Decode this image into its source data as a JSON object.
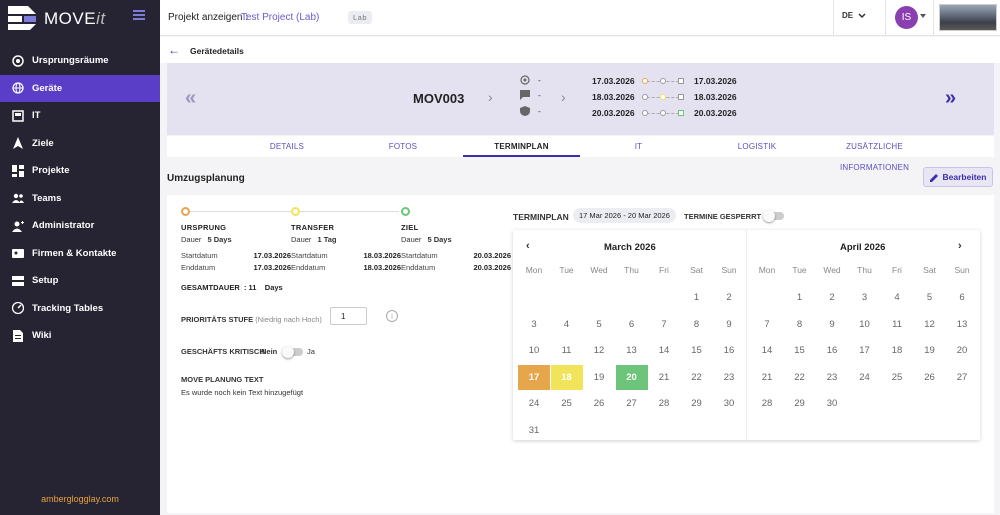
{
  "app": {
    "name_main": "MOVE",
    "name_suffix": "it"
  },
  "colors": {
    "sidebar": "#262433",
    "accent": "#5a3ec8",
    "primary": "#3c2ea8",
    "ursprung": "#e6a64c",
    "transfer": "#f2e45a",
    "ziel": "#6cc57a"
  },
  "sidebar": {
    "items": [
      {
        "label": "Ursprungsräume",
        "icon": "target-icon"
      },
      {
        "label": "Geräte",
        "icon": "globe-icon",
        "active": true
      },
      {
        "label": "IT",
        "icon": "monitor-icon"
      },
      {
        "label": "Ziele",
        "icon": "navigation-icon"
      },
      {
        "label": "Projekte",
        "icon": "dashboard-icon"
      },
      {
        "label": "Teams",
        "icon": "group-icon"
      },
      {
        "label": "Administrator",
        "icon": "admin-icon"
      },
      {
        "label": "Firmen & Kontakte",
        "icon": "contacts-icon"
      },
      {
        "label": "Setup",
        "icon": "storage-icon"
      },
      {
        "label": "Tracking Tables",
        "icon": "gauge-icon"
      },
      {
        "label": "Wiki",
        "icon": "document-icon"
      }
    ],
    "footer": "amberglogglay.com"
  },
  "topbar": {
    "project_label": "Projekt anzeigen :",
    "project_name": "Test Project (Lab)",
    "badge": "Lab",
    "language": "DE",
    "user_initials": "IS"
  },
  "subheader": {
    "title": "Gerätedetails"
  },
  "device": {
    "name": "MOV003",
    "status": [
      {
        "icon": "crosshair-icon",
        "value": "-"
      },
      {
        "icon": "comment-icon",
        "value": "-"
      },
      {
        "icon": "shield-icon",
        "value": "-"
      }
    ],
    "timeline": [
      {
        "start": "17.03.2026",
        "end": "17.03.2026"
      },
      {
        "start": "18.03.2026",
        "end": "18.03.2026"
      },
      {
        "start": "20.03.2026",
        "end": "20.03.2026"
      }
    ]
  },
  "tabs": [
    "DETAILS",
    "FOTOS",
    "TERMINPLAN",
    "IT",
    "LOGISTIK",
    "ZUSÄTZLICHE INFORMATIONEN"
  ],
  "section": {
    "title": "Umzugsplanung",
    "edit_label": "Bearbeiten"
  },
  "phases": [
    {
      "name": "URSPRUNG",
      "duration_label": "Dauer",
      "duration": "5 Days",
      "start_label": "Startdatum",
      "start": "17.03.2026",
      "end_label": "Enddatum",
      "end": "17.03.2026"
    },
    {
      "name": "TRANSFER",
      "duration_label": "Dauer",
      "duration": "1 Tag",
      "start_label": "Startdatum",
      "start": "18.03.2026",
      "end_label": "Enddatum",
      "end": "18.03.2026"
    },
    {
      "name": "ZIEL",
      "duration_label": "Dauer",
      "duration": "5 Days",
      "start_label": "Startdatum",
      "start": "20.03.2026",
      "end_label": "Enddatum",
      "end": "20.03.2026"
    }
  ],
  "planning": {
    "total_label": "GESAMTDAUER",
    "total_value": ": 11",
    "total_unit": "Days",
    "priority_label": "PRIORITÄTS STUFE",
    "priority_hint": "(Niedrig nach Hoch)",
    "priority_value": "1",
    "critical_label": "GESCHÄFTS KRITISCH",
    "critical_no": "Nein",
    "critical_yes": "Ja",
    "text_label": "MOVE PLANUNG TEXT",
    "text_value": "Es wurde noch kein Text hinzugefügt"
  },
  "terminplan": {
    "label": "TERMINPLAN",
    "range": "17 Mar 2026 - 20 Mar 2026",
    "locked_label": "TERMINE GESPERRT"
  },
  "calendar": {
    "weekdays": [
      "Mon",
      "Tue",
      "Wed",
      "Thu",
      "Fri",
      "Sat",
      "Sun"
    ],
    "months": [
      {
        "title": "March 2026",
        "first_weekday": 6,
        "days": 31,
        "highlights": {
          "17": "orange",
          "18": "yellow",
          "20": "green"
        }
      },
      {
        "title": "April 2026",
        "first_weekday": 2,
        "days": 30,
        "highlights": {}
      }
    ]
  }
}
